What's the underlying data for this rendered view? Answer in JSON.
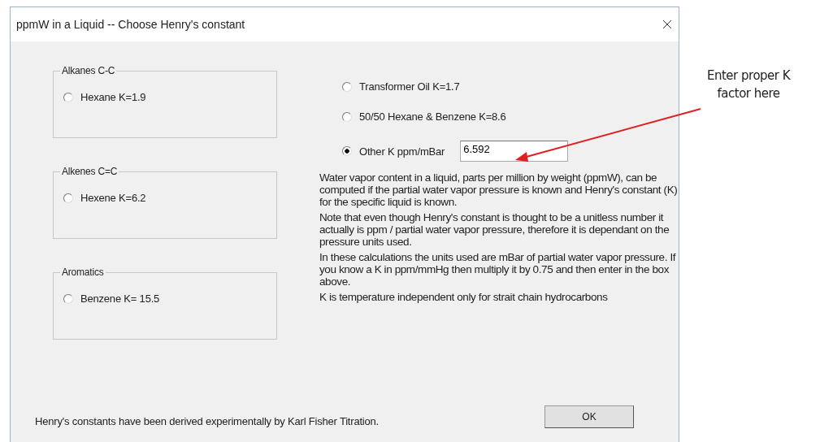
{
  "window": {
    "title": "ppmW in a Liquid  -- Choose Henry's constant"
  },
  "groups": [
    {
      "title": "Alkanes   C-C",
      "options": [
        {
          "label": "Hexane K=1.9",
          "selected": false
        }
      ]
    },
    {
      "title": "Alkenes   C=C",
      "options": [
        {
          "label": "Hexene K=6.2",
          "selected": false
        }
      ]
    },
    {
      "title": "Aromatics",
      "options": [
        {
          "label": "Benzene K= 15.5",
          "selected": false
        }
      ]
    }
  ],
  "options": [
    {
      "kind": "plain",
      "label": "Transformer Oil K=1.7",
      "selected": false
    },
    {
      "kind": "plain",
      "label": "50/50 Hexane & Benzene K=8.6",
      "selected": false
    },
    {
      "kind": "field",
      "label": "Other K ppm/mBar",
      "selected": true,
      "value": "6.592"
    }
  ],
  "notes": [
    "Water vapor content in a liquid, parts per million by weight (ppmW), can be computed if the partial water vapor pressure is known and Henry's constant (K) for the specific liquid is known.",
    "Note that even though Henry's constant is thought to be a unitless number it actually is ppm / partial water vapor pressure, therefore it is dependant on the pressure units used.",
    "In these calculations the units used are mBar of partial water vapor pressure. If you know a K in ppm/mmHg then multiply it by 0.75 and then enter in the box above.",
    "K is temperature independent only for strait chain hydrocarbons"
  ],
  "footer": "Henry's constants have been derived experimentally by Karl Fisher Titration.",
  "ok_button": "OK",
  "annotation": "Enter proper K\nfactor here"
}
